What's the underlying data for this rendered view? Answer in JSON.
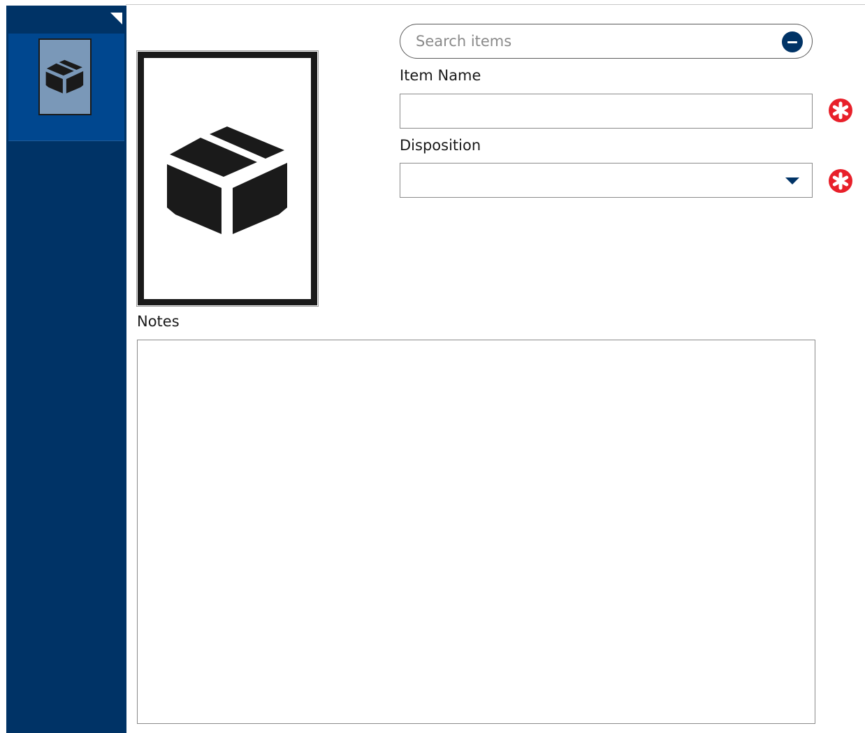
{
  "sidebar": {
    "collapse_icon": "corner-triangle-icon",
    "items": [
      {
        "icon": "package-box-icon",
        "selected": true
      }
    ],
    "colors": {
      "background": "#003366",
      "selected_item": "#00478f",
      "thumbnail": "#7a98b8"
    }
  },
  "image": {
    "icon": "package-box-icon"
  },
  "search": {
    "placeholder": "Search items",
    "value": "",
    "button_icon": "minus-circle-icon"
  },
  "form": {
    "item_name_label": "Item Name",
    "item_name_value": "",
    "disposition_label": "Disposition",
    "disposition_value": "",
    "required_icon": "required-asterisk-icon",
    "required_color": "#e8202a"
  },
  "notes": {
    "label": "Notes",
    "value": ""
  }
}
